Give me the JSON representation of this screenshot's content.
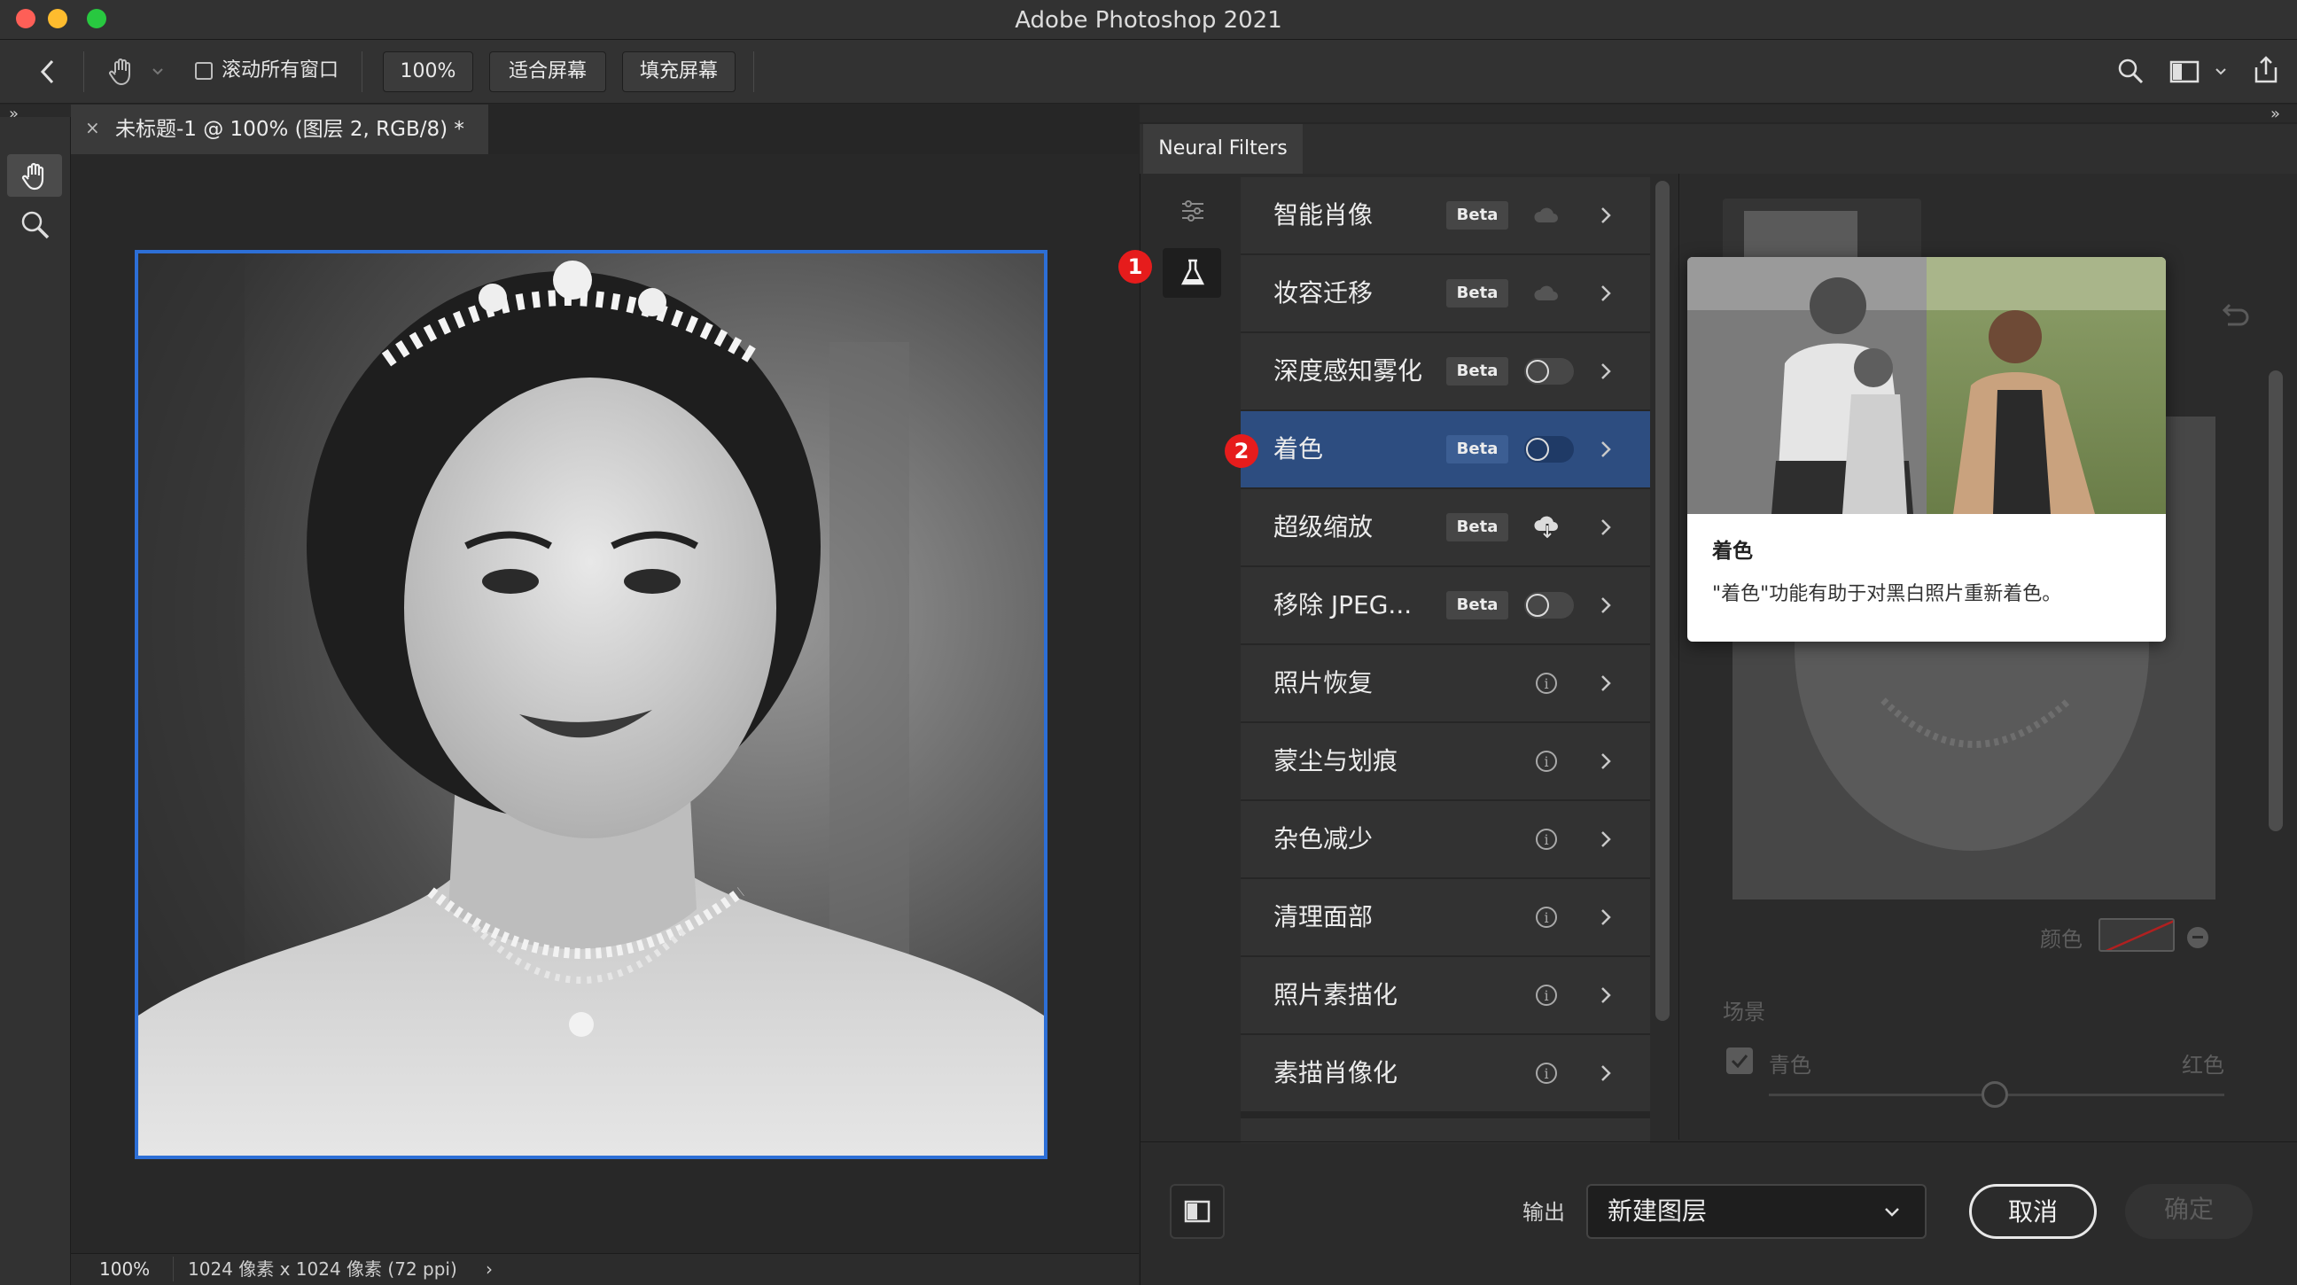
{
  "window": {
    "title": "Adobe Photoshop 2021"
  },
  "options_bar": {
    "scroll_all_label": "滚动所有窗口",
    "zoom_btn": "100%",
    "fit_screen_btn": "适合屏幕",
    "fill_screen_btn": "填充屏幕"
  },
  "document": {
    "tab_title": "未标题-1 @ 100% (图层 2, RGB/8) *",
    "zoom": "100%",
    "dimensions": "1024 像素 x 1024 像素 (72 ppi)"
  },
  "neural_filters": {
    "panel_title": "Neural Filters",
    "filters": [
      {
        "name": "智能肖像",
        "badge": "Beta",
        "control": "cloud"
      },
      {
        "name": "妆容迁移",
        "badge": "Beta",
        "control": "cloud"
      },
      {
        "name": "深度感知雾化",
        "badge": "Beta",
        "control": "toggle"
      },
      {
        "name": "着色",
        "badge": "Beta",
        "control": "toggle",
        "selected": true
      },
      {
        "name": "超级缩放",
        "badge": "Beta",
        "control": "download"
      },
      {
        "name": "移除 JPEG...",
        "badge": "Beta",
        "control": "toggle"
      },
      {
        "name": "照片恢复",
        "badge": "",
        "control": "info"
      },
      {
        "name": "蒙尘与划痕",
        "badge": "",
        "control": "info"
      },
      {
        "name": "杂色减少",
        "badge": "",
        "control": "info"
      },
      {
        "name": "清理面部",
        "badge": "",
        "control": "info"
      },
      {
        "name": "照片素描化",
        "badge": "",
        "control": "info"
      },
      {
        "name": "素描肖像化",
        "badge": "",
        "control": "info"
      }
    ],
    "tooltip": {
      "title": "着色",
      "description": "\"着色\"功能有助于对黑白照片重新着色。"
    },
    "settings": {
      "color_label": "颜色",
      "scene_label": "场景",
      "cyan_label": "青色",
      "red_label": "红色"
    },
    "footer": {
      "output_label": "输出",
      "output_value": "新建图层",
      "cancel_label": "取消",
      "ok_label": "确定"
    }
  },
  "annotations": {
    "marker_1": "1",
    "marker_2": "2"
  },
  "colors": {
    "accent_blue": "#2d4d80",
    "canvas_border": "#2d6fd6",
    "badge_red": "#e61c1c"
  }
}
